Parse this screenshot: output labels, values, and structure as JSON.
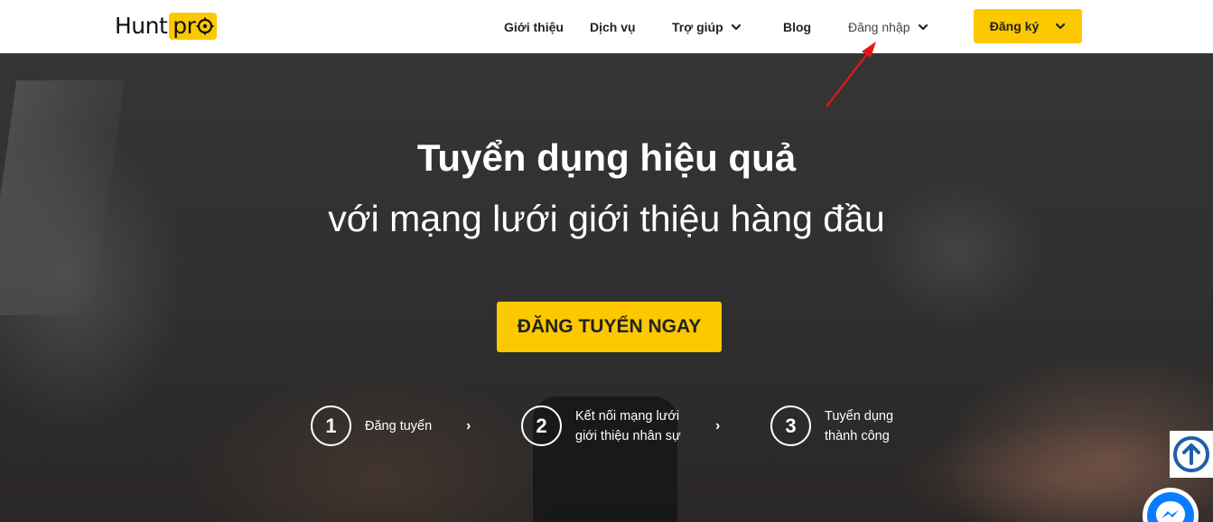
{
  "brand": {
    "logo_hunt": "Hunt",
    "logo_pro": "pr"
  },
  "nav": {
    "items": [
      {
        "label": "Giới thiệu"
      },
      {
        "label": "Dịch vụ"
      },
      {
        "label": "Trợ giúp"
      },
      {
        "label": "Blog"
      },
      {
        "label": "Đăng nhập"
      }
    ],
    "register_label": "Đăng ký"
  },
  "hero": {
    "title": "Tuyển dụng hiệu quả",
    "subtitle": "với mạng lưới giới thiệu hàng đầu",
    "cta_label": "ĐĂNG TUYỂN NGAY"
  },
  "steps": [
    {
      "number": "1",
      "line1": "Đăng tuyển",
      "line2": ""
    },
    {
      "number": "2",
      "line1": "Kết nối mạng lưới",
      "line2": "giới thiệu nhân sự"
    },
    {
      "number": "3",
      "line1": "Tuyển dụng",
      "line2": "thành công"
    }
  ],
  "step_separator": "›",
  "colors": {
    "accent": "#fcc900",
    "nav_bg": "#ffffff",
    "annotation": "#e8141c",
    "scroll_icon": "#1f5fa8",
    "messenger": "#0a7cff"
  },
  "icons": [
    "target-icon",
    "chevron-down-icon",
    "arrow-up-circle-icon",
    "messenger-icon",
    "annotation-arrow-icon"
  ]
}
